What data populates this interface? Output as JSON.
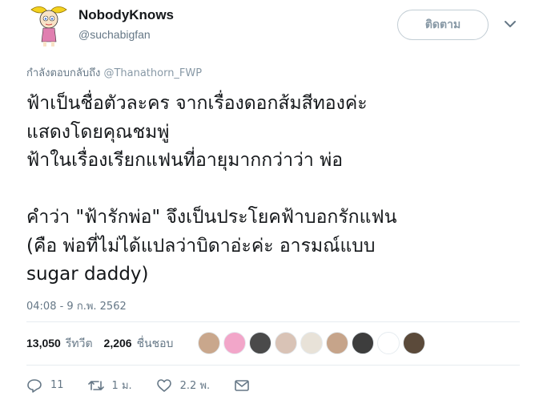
{
  "user": {
    "display_name": "NobodyKnows",
    "handle": "@suchabigfan"
  },
  "follow_label": "ติดตาม",
  "reply_to": {
    "prefix": "กำลังตอบกลับถึง ",
    "mention": "@Thanathorn_FWP"
  },
  "tweet_text": "ฟ้าเป็นชื่อตัวละคร จากเรื่องดอกส้มสีทองค่ะ\nแสดงโดยคุณชมพู่\nฟ้าในเรื่องเรียกแฟนที่อายุมากกว่าว่า พ่อ\n\nคำว่า \"ฟ้ารักพ่อ\" จึงเป็นประโยคฟ้าบอกรักแฟน\n(คือ พ่อที่ไม่ได้แปลว่าบิดาอ่ะค่ะ อารมณ์แบบ\nsugar daddy)",
  "timestamp": "04:08 - 9 ก.พ. 2562",
  "stats": {
    "retweets_count": "13,050",
    "retweets_label": "รีทวีต",
    "likes_count": "2,206",
    "likes_label": "ชื่นชอบ"
  },
  "likers": [
    {
      "color": "#c9a78c"
    },
    {
      "color": "#f2a6c9"
    },
    {
      "color": "#4a4a4a"
    },
    {
      "color": "#d9c3b6"
    },
    {
      "color": "#e8e2d8"
    },
    {
      "color": "#c6a48a"
    },
    {
      "color": "#3d3d3d"
    },
    {
      "color": "#ffffff"
    },
    {
      "color": "#5b4a3a"
    }
  ],
  "actions": {
    "replies": "11",
    "retweets": "1 ม.",
    "likes": "2.2 พ."
  }
}
